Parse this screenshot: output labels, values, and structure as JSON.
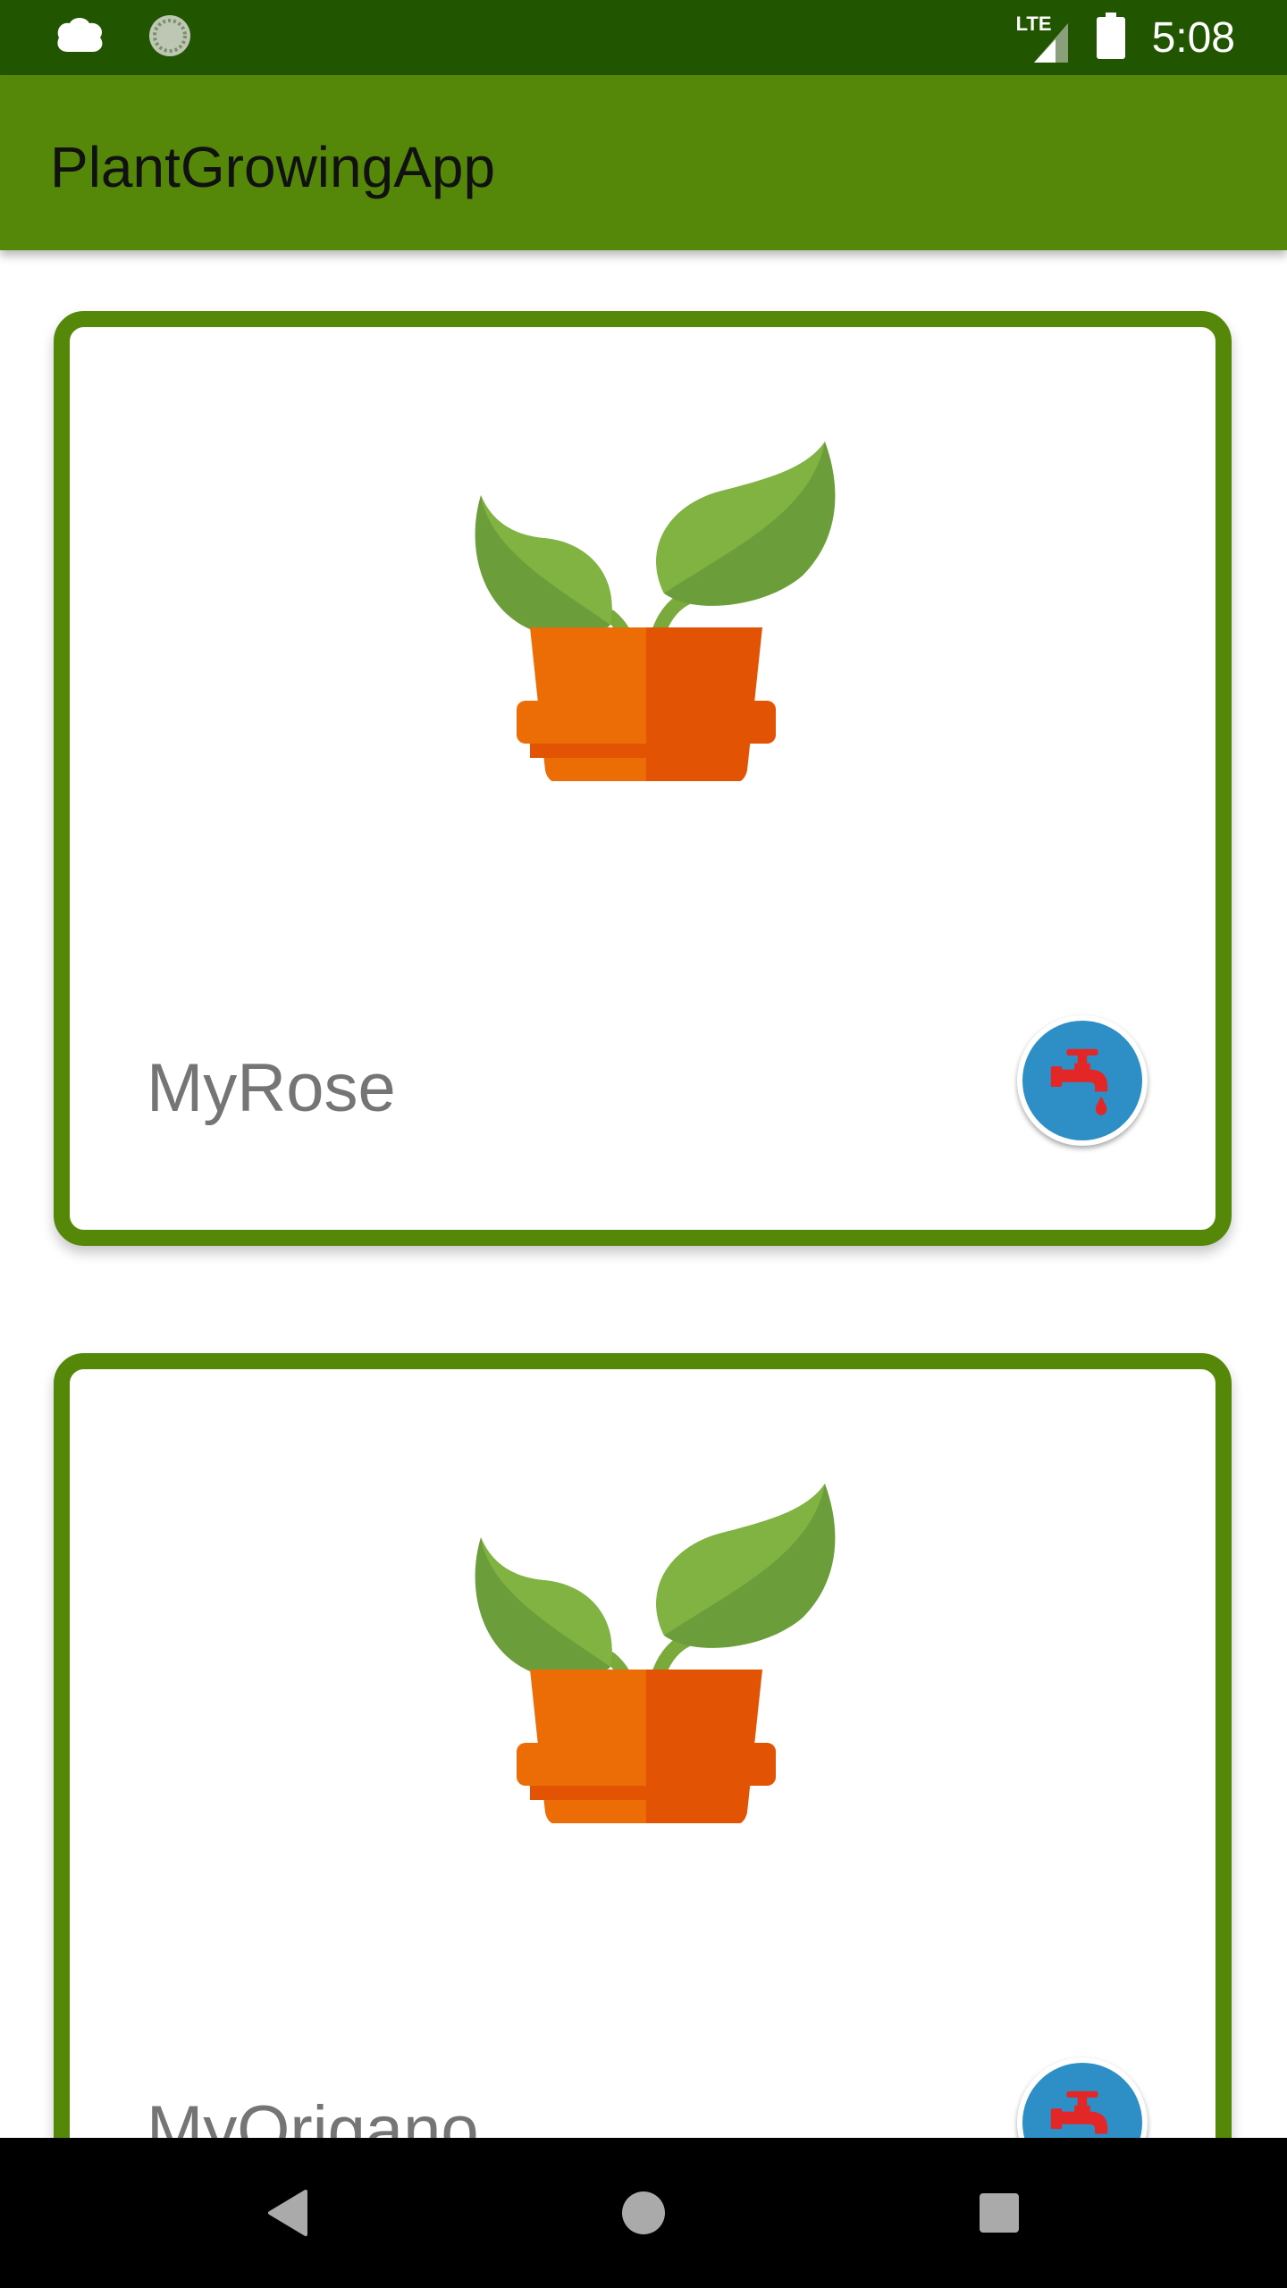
{
  "status_bar": {
    "time": "5:08",
    "network_label": "LTE",
    "icons": [
      "cloud-notification-icon",
      "sync-icon",
      "signal-icon",
      "battery-icon"
    ]
  },
  "app_bar": {
    "title": "PlantGrowingApp"
  },
  "plants": [
    {
      "name": "MyRose",
      "image": "potted-plant-icon",
      "action": "faucet-icon"
    },
    {
      "name": "MyOrigano",
      "image": "potted-plant-icon",
      "action": "faucet-icon"
    }
  ],
  "colors": {
    "status_bar": "#225500",
    "app_bar": "#558808",
    "card_border": "#558808",
    "water_button": "#2e8fc7",
    "faucet": "#e32626"
  },
  "nav_bar": {
    "buttons": [
      "back-icon",
      "home-icon",
      "recents-icon"
    ]
  }
}
